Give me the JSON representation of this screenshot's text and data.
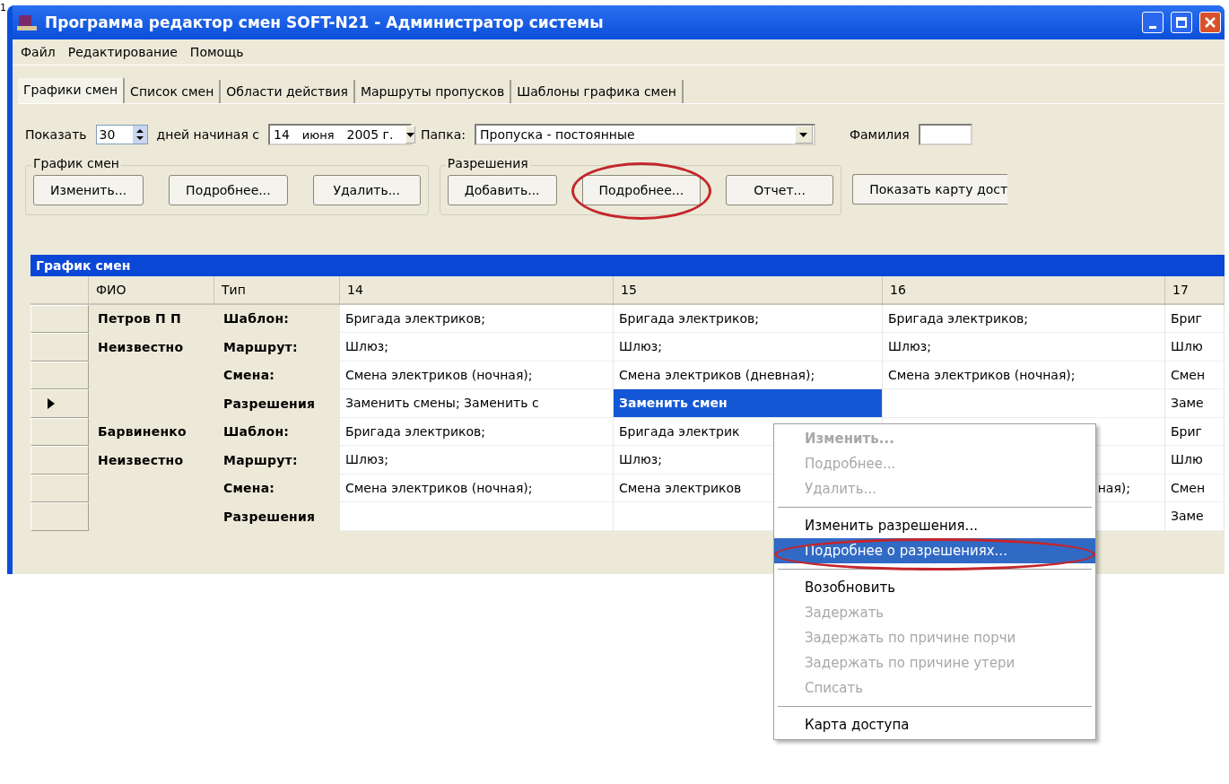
{
  "corner_mark": "1",
  "window": {
    "title": "Программа редактор смен SOFT-N21 - Администратор системы"
  },
  "menu_bar": [
    "Файл",
    "Редактирование",
    "Помощь"
  ],
  "tabs": [
    {
      "label": "Графики смен",
      "selected": true
    },
    {
      "label": "Список смен",
      "selected": false
    },
    {
      "label": "Области действия",
      "selected": false
    },
    {
      "label": "Маршруты пропусков",
      "selected": false
    },
    {
      "label": "Шаблоны графика смен",
      "selected": false
    }
  ],
  "filter": {
    "show_label": "Показать",
    "days_value": "30",
    "days_label": "дней начиная с",
    "date": {
      "day": "14",
      "month": "июня",
      "year": "2005 г."
    },
    "folder_label": "Папка:",
    "folder_value": "Пропуска - постоянные",
    "surname_label": "Фамилия"
  },
  "groups": [
    {
      "title": "График смен",
      "buttons": [
        {
          "label": "Изменить...",
          "circled": false
        },
        {
          "label": "Подробнее...",
          "circled": false
        },
        {
          "label": "Удалить...",
          "circled": false
        }
      ]
    },
    {
      "title": "Разрешения",
      "buttons": [
        {
          "label": "Добавить...",
          "circled": false
        },
        {
          "label": "Подробнее...",
          "circled": true
        },
        {
          "label": "Отчет...",
          "circled": false
        }
      ]
    }
  ],
  "access_map_button": "Показать карту дост",
  "grid": {
    "title": "График смен",
    "columns": [
      "ФИО",
      "Тип",
      "14",
      "15",
      "16",
      "17"
    ],
    "rows": [
      {
        "current": false,
        "cells": [
          {
            "text": "Петров П П"
          },
          {
            "text": "Шаблон:"
          },
          {
            "text": "Бригада электриков;",
            "selected": false
          },
          {
            "text": "Бригада электриков;",
            "selected": false
          },
          {
            "text": "Бригада электриков;",
            "selected": false
          },
          {
            "text": "Бриг",
            "selected": false
          }
        ]
      },
      {
        "current": false,
        "cells": [
          {
            "text": "Неизвестно"
          },
          {
            "text": "Маршрут:"
          },
          {
            "text": "Шлюз;",
            "selected": false
          },
          {
            "text": "Шлюз;",
            "selected": false
          },
          {
            "text": "Шлюз;",
            "selected": false
          },
          {
            "text": "Шлю",
            "selected": false
          }
        ]
      },
      {
        "current": false,
        "cells": [
          {
            "text": ""
          },
          {
            "text": "Смена:"
          },
          {
            "text": "Смена электриков (ночная);",
            "selected": false
          },
          {
            "text": "Смена электриков (дневная);",
            "selected": false
          },
          {
            "text": "Смена электриков (ночная);",
            "selected": false
          },
          {
            "text": "Смен",
            "selected": false
          }
        ]
      },
      {
        "current": true,
        "cells": [
          {
            "text": ""
          },
          {
            "text": "Разрешения"
          },
          {
            "text": "Заменить смены; Заменить с",
            "selected": false
          },
          {
            "text": "Заменить смен",
            "selected": true
          },
          {
            "selected": false
          },
          {
            "text": "Заме",
            "selected": false
          }
        ]
      },
      {
        "current": false,
        "cells": [
          {
            "text": "Барвиненко"
          },
          {
            "text": "Шаблон:"
          },
          {
            "text": "Бригада электриков;",
            "selected": false
          },
          {
            "text": "Бригада электрик",
            "selected": false
          },
          {
            "selected": false
          },
          {
            "text": "Бриг",
            "selected": false
          }
        ]
      },
      {
        "current": false,
        "cells": [
          {
            "text": "Неизвестно"
          },
          {
            "text": "Маршрут:"
          },
          {
            "text": "Шлюз;",
            "selected": false
          },
          {
            "text": "Шлюз;",
            "selected": false
          },
          {
            "selected": false
          },
          {
            "text": "Шлю",
            "selected": false
          }
        ]
      },
      {
        "current": false,
        "cells": [
          {
            "text": ""
          },
          {
            "text": "Смена:"
          },
          {
            "text": "Смена электриков (ночная);",
            "selected": false
          },
          {
            "text": "Смена электриков",
            "selected": false
          },
          {
            "text": "ная);",
            "selected": false,
            "covered": true
          },
          {
            "text": "Смен",
            "selected": false
          }
        ]
      },
      {
        "current": false,
        "cells": [
          {
            "text": ""
          },
          {
            "text": "Разрешения"
          },
          {
            "selected": false
          },
          {
            "selected": false
          },
          {
            "selected": false
          },
          {
            "text": "Заме",
            "selected": false
          }
        ]
      }
    ]
  },
  "context_menu": [
    {
      "kind": "item",
      "label": "Изменить...",
      "disabled": true,
      "bold": true,
      "selected": false,
      "circled": false
    },
    {
      "kind": "item",
      "label": "Подробнее...",
      "disabled": true,
      "bold": false,
      "selected": false,
      "circled": false
    },
    {
      "kind": "item",
      "label": "Удалить...",
      "disabled": true,
      "bold": false,
      "selected": false,
      "circled": false
    },
    {
      "kind": "separator"
    },
    {
      "kind": "item",
      "label": "Изменить разрешения...",
      "disabled": false,
      "bold": false,
      "selected": false,
      "circled": false
    },
    {
      "kind": "item",
      "label": "Подробнее о разрешениях...",
      "disabled": false,
      "bold": false,
      "selected": true,
      "circled": true
    },
    {
      "kind": "separator"
    },
    {
      "kind": "item",
      "label": "Возобновить",
      "disabled": false,
      "bold": false,
      "selected": false,
      "circled": false
    },
    {
      "kind": "item",
      "label": "Задержать",
      "disabled": true,
      "bold": false,
      "selected": false,
      "circled": false
    },
    {
      "kind": "item",
      "label": "Задержать по причине порчи",
      "disabled": true,
      "bold": false,
      "selected": false,
      "circled": false
    },
    {
      "kind": "item",
      "label": "Задержать по причине утери",
      "disabled": true,
      "bold": false,
      "selected": false,
      "circled": false
    },
    {
      "kind": "item",
      "label": "Списать",
      "disabled": true,
      "bold": false,
      "selected": false,
      "circled": false
    },
    {
      "kind": "separator"
    },
    {
      "kind": "item",
      "label": "Карта доступа",
      "disabled": false,
      "bold": false,
      "selected": false,
      "circled": false
    }
  ]
}
